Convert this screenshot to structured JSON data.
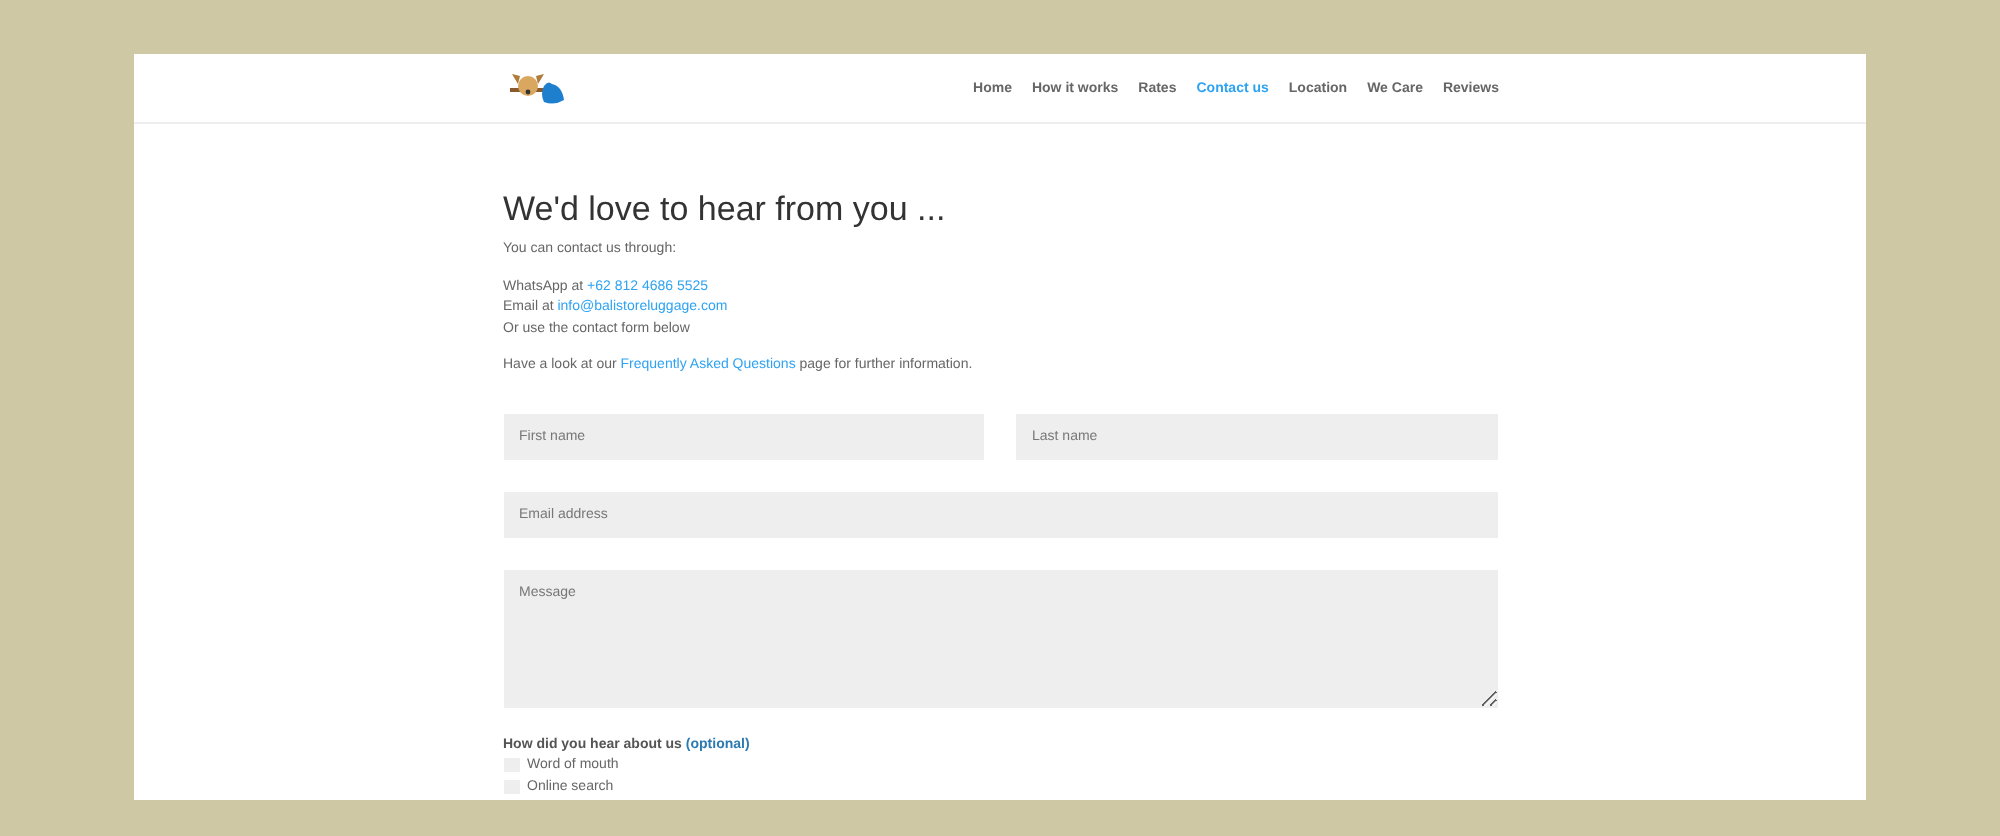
{
  "nav": {
    "items": [
      {
        "label": "Home",
        "selected": false
      },
      {
        "label": "How it works",
        "selected": false
      },
      {
        "label": "Rates",
        "selected": false
      },
      {
        "label": "Contact us",
        "selected": true
      },
      {
        "label": "Location",
        "selected": false
      },
      {
        "label": "We Care",
        "selected": false
      },
      {
        "label": "Reviews",
        "selected": false
      }
    ]
  },
  "heading": "We'd love to hear from you ...",
  "intro": "You can contact us through:",
  "contact_lines": [
    {
      "before": "WhatsApp at ",
      "link": "+62 812 4686 5525"
    },
    {
      "before": "Email at ",
      "link": "info@balistoreluggage.com"
    },
    {
      "before": "Or use the contact form below"
    }
  ],
  "faq_line": {
    "before": "Have a look at our ",
    "link": "Frequently Asked Questions",
    "after": " page for further information."
  },
  "form": {
    "first_name": {
      "placeholder": "First name"
    },
    "last_name": {
      "placeholder": "Last name"
    },
    "email": {
      "placeholder": "Email address"
    },
    "message": {
      "placeholder": "Message"
    },
    "source": {
      "label": "How did you hear about us",
      "hint": "(optional)",
      "options": [
        {
          "label": "Word of mouth",
          "checked": false
        },
        {
          "label": "Online search",
          "checked": false
        }
      ]
    }
  }
}
